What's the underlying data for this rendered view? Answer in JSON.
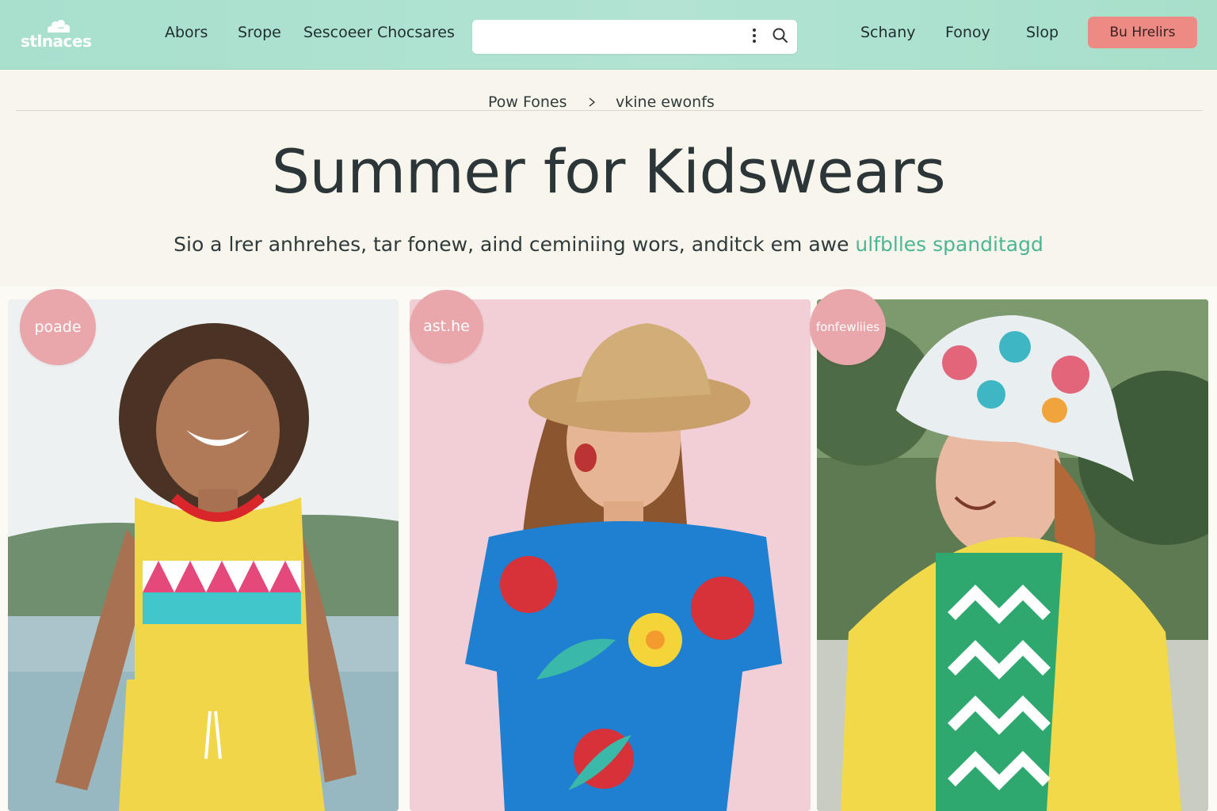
{
  "header": {
    "logo_text": "stlnaces",
    "nav_left": [
      "Abors",
      "Srope",
      "Sescoeer Chocsares"
    ],
    "search": {
      "value": "",
      "placeholder": ""
    },
    "nav_right": [
      "Schany",
      "Fonoy",
      "Slop"
    ],
    "cta_label": "Bu Hrelirs",
    "icons": [
      "logo-mark",
      "kebab-icon",
      "search-icon"
    ]
  },
  "breadcrumb": {
    "items": [
      "Pow Fones",
      "vkine ewonfs"
    ],
    "separator_icon": "caret-right-icon"
  },
  "hero": {
    "title": "Summer for Kidswears",
    "subtitle": "Sio a lrer anhrehes, tar fonew, aind ceminiing wors, anditck em awe",
    "subtitle_accent": "ulfblles spanditagd"
  },
  "cards": [
    {
      "badge": "poade",
      "image": "smiling child in yellow tank top with zigzag stripe by the sea"
    },
    {
      "badge": "ast.he",
      "image": "laughing girl in straw hat and blue floral t-shirt"
    },
    {
      "badge": "fonfewliies",
      "image": "smiling child in floral bucket hat and yellow jacket"
    }
  ],
  "colors": {
    "header_bg": "#a8dfcd",
    "cta_bg": "#ec8a84",
    "badge_bg": "#e9a7ac",
    "accent_text": "#4cb596",
    "page_bg": "#f8f6ec"
  }
}
